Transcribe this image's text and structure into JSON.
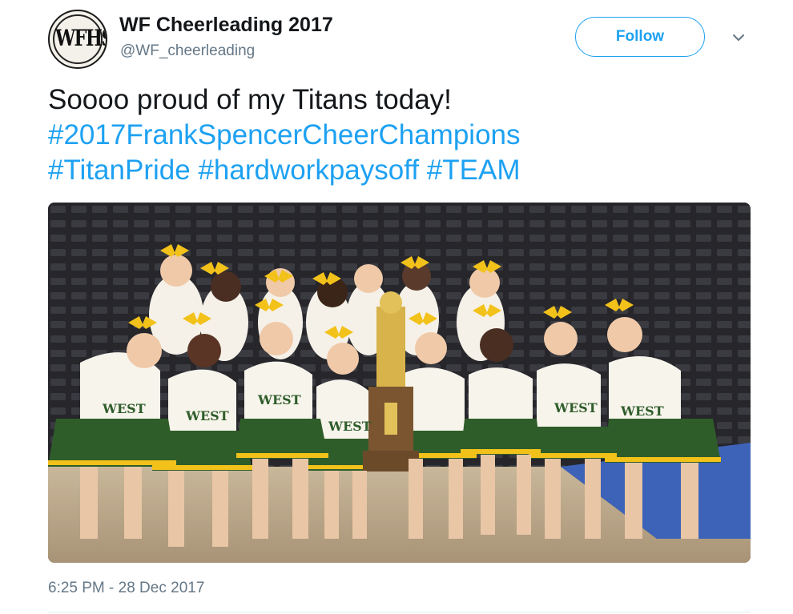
{
  "tweet": {
    "author": {
      "display_name": "WF Cheerleading 2017",
      "handle": "@WF_cheerleading",
      "avatar_text": "WFHS",
      "avatar_icon": "wfhs-logo"
    },
    "follow_label": "Follow",
    "menu_icon": "chevron-down-icon",
    "text": {
      "plain": "Soooo proud of my Titans today!",
      "hashtags": [
        "#2017FrankSpencerCheerChampions",
        "#TitanPride",
        "#hardworkpaysoff",
        "#TEAM"
      ]
    },
    "media": {
      "type": "photo",
      "uniform_text": "WEST"
    },
    "timestamp": "6:25 PM - 28 Dec 2017"
  },
  "colors": {
    "link": "#1da1f2",
    "text": "#14171a",
    "secondary": "#657786",
    "uniform_green": "#2f5d2a",
    "bow_yellow": "#f2c21a"
  }
}
